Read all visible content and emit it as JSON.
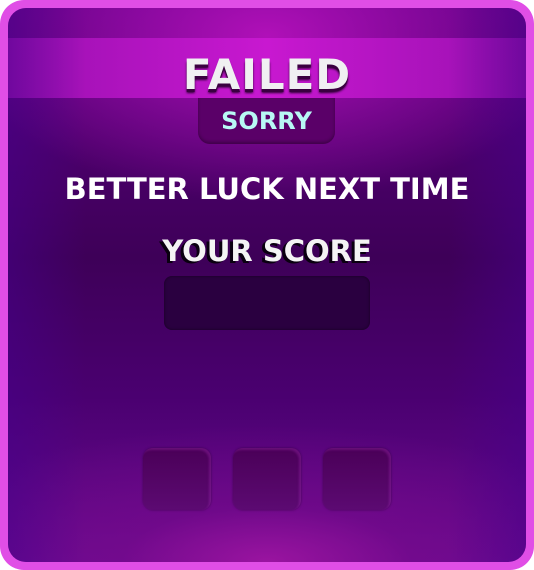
{
  "title": "FAILED",
  "subtitle": "SORRY",
  "message": "BETTER LUCK NEXT TIME",
  "score_label": "YOUR SCORE",
  "colors": {
    "frame": "#e04ee6",
    "title_band": "#c818d0",
    "sorry_text": "#b8f8f4"
  }
}
